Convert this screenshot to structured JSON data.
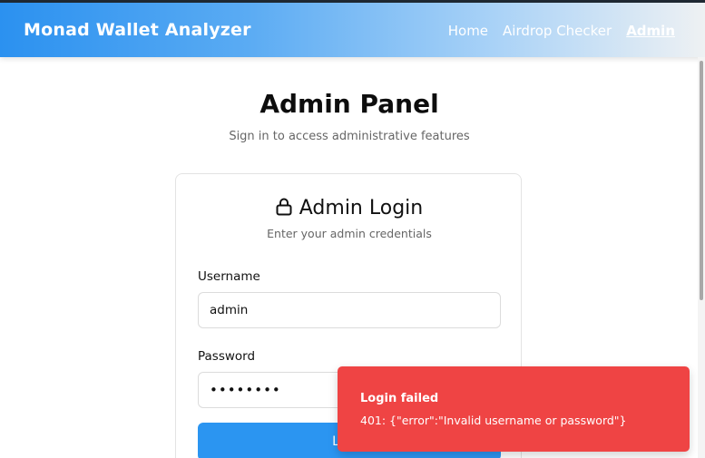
{
  "navbar": {
    "brand": "Monad Wallet Analyzer",
    "links": [
      {
        "label": "Home",
        "active": false
      },
      {
        "label": "Airdrop Checker",
        "active": false
      },
      {
        "label": "Admin",
        "active": true
      }
    ]
  },
  "header": {
    "title": "Admin Panel",
    "subtitle": "Sign in to access administrative features"
  },
  "login_card": {
    "icon": "lock-icon",
    "title": "Admin Login",
    "subtitle": "Enter your admin credentials",
    "username_label": "Username",
    "username_value": "admin",
    "password_label": "Password",
    "password_value": "••••••••",
    "button_label": "Login"
  },
  "toast": {
    "title": "Login failed",
    "message": "401: {\"error\":\"Invalid username or password\"}"
  },
  "colors": {
    "accent": "#2b95f1",
    "error": "#ef4444"
  }
}
